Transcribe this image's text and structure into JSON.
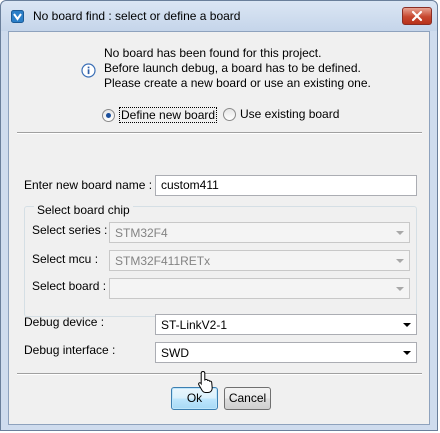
{
  "window": {
    "title": "No board find : select or define a board",
    "app_icon": "app-icon",
    "close_icon": "close-icon"
  },
  "message": {
    "icon": "info-icon",
    "line1": "No board has been found for this project.",
    "line2": "Before launch debug, a board has to be defined.",
    "line3": "Please create a new board or use an existing one."
  },
  "mode": {
    "define_new_label": "Define new board",
    "use_existing_label": "Use existing board",
    "selected": "define_new"
  },
  "board_name": {
    "label": "Enter new board name :",
    "value": "custom411"
  },
  "board_chip": {
    "group_title": "Select board chip",
    "series_label": "Select series :",
    "series_value": "STM32F4",
    "mcu_label": "Select mcu :",
    "mcu_value": "STM32F411RETx",
    "board_label": "Select board :",
    "board_value": ""
  },
  "debug": {
    "device_label": "Debug device :",
    "device_value": "ST-LinkV2-1",
    "interface_label": "Debug interface :",
    "interface_value": "SWD"
  },
  "buttons": {
    "ok_label": "Ok",
    "cancel_label": "Cancel"
  },
  "colors": {
    "client_bg": "#f0f0f0",
    "titlebar": "#cfdcee",
    "close_button": "#c7472f",
    "default_button": "#bee6fd"
  }
}
